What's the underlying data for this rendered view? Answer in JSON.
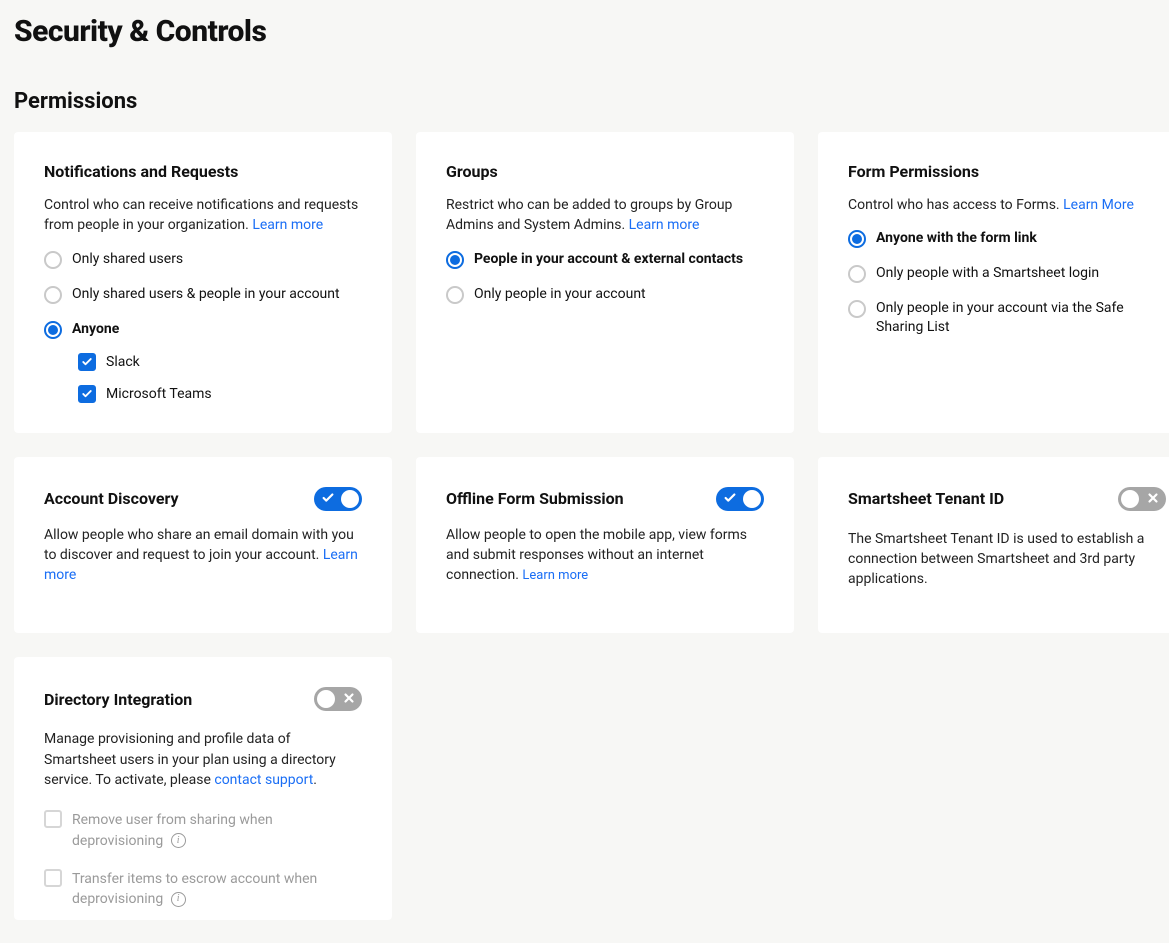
{
  "page": {
    "title": "Security & Controls",
    "section": "Permissions"
  },
  "cards": {
    "notifications": {
      "title": "Notifications and Requests",
      "desc": "Control who can receive notifications and requests from people in your organization. ",
      "learn": "Learn more",
      "options": [
        {
          "label": "Only shared users",
          "selected": false
        },
        {
          "label": "Only shared users & people in your account",
          "selected": false
        },
        {
          "label": "Anyone",
          "selected": true
        }
      ],
      "subchecks": [
        {
          "label": "Slack",
          "checked": true
        },
        {
          "label": "Microsoft Teams",
          "checked": true
        }
      ]
    },
    "groups": {
      "title": "Groups",
      "desc": "Restrict who can be added to groups by Group Admins and System Admins. ",
      "learn": "Learn more",
      "options": [
        {
          "label": "People in your account & external contacts",
          "selected": true
        },
        {
          "label": "Only people in your account",
          "selected": false
        }
      ]
    },
    "forms": {
      "title": "Form Permissions",
      "desc": "Control who has access to Forms. ",
      "learn": "Learn More",
      "options": [
        {
          "label": "Anyone with the form link",
          "selected": true
        },
        {
          "label": "Only people with a Smartsheet login",
          "selected": false
        },
        {
          "label": "Only people in your account via the Safe Sharing List",
          "selected": false
        }
      ]
    },
    "discovery": {
      "title": "Account Discovery",
      "toggle": true,
      "desc": "Allow people who share an email domain with you to discover and request to join your account. ",
      "learn": "Learn more"
    },
    "offline": {
      "title": "Offline Form Submission",
      "toggle": true,
      "desc": "Allow people to open the mobile app, view forms and submit responses without an internet connection. ",
      "learn": "Learn more"
    },
    "tenant": {
      "title": "Smartsheet Tenant ID",
      "toggle": false,
      "desc": "The Smartsheet Tenant ID is used to establish a connection between Smartsheet and 3rd party applications."
    },
    "directory": {
      "title": "Directory Integration",
      "toggle": false,
      "desc_pre": "Manage provisioning and profile data of Smartsheet users in your plan using a directory service. To activate, please ",
      "contact": "contact support",
      "desc_post": ".",
      "checks": [
        {
          "label": "Remove user from sharing when deprovisioning"
        },
        {
          "label": "Transfer items to escrow account when deprovisioning"
        }
      ]
    }
  }
}
